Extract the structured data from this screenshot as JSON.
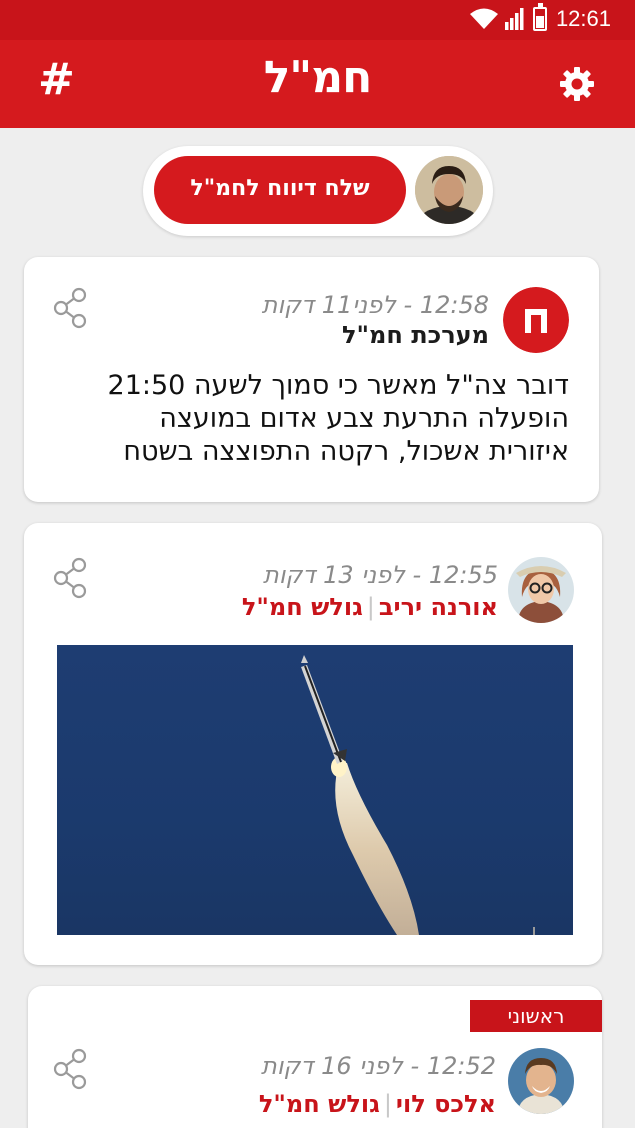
{
  "status_bar": {
    "time": "12:61",
    "wifi_icon": "wifi-icon",
    "signal_icon": "signal-icon",
    "battery_icon": "battery-icon"
  },
  "app_bar": {
    "title": "חמ\"ל",
    "menu_symbol": "#",
    "settings_icon": "gear-icon"
  },
  "report": {
    "button_label": "שלח דיווח לחמ\"ל"
  },
  "feed": [
    {
      "time": "12:58 - לפני11 דקות",
      "author": "מערכת חמ\"ל",
      "text_lines": [
        "דובר צה\"ל מאשר כי סמוך לשעה 21:50",
        "הופעלה התרעת צבע אדום במועצה",
        "איזורית אשכול, רקטה התפוצצה בשטח"
      ]
    },
    {
      "time": "12:55 - לפני 13 דקות",
      "author": "אורנה יריב",
      "source": "גולש חמ\"ל"
    },
    {
      "badge": "ראשוני",
      "time": "12:52 - לפני 16 דקות",
      "author": "אלכס לוי",
      "source": "גולש חמ\"ל"
    }
  ],
  "colors": {
    "brand_red": "#d51a1e",
    "background": "#eeeeee"
  }
}
